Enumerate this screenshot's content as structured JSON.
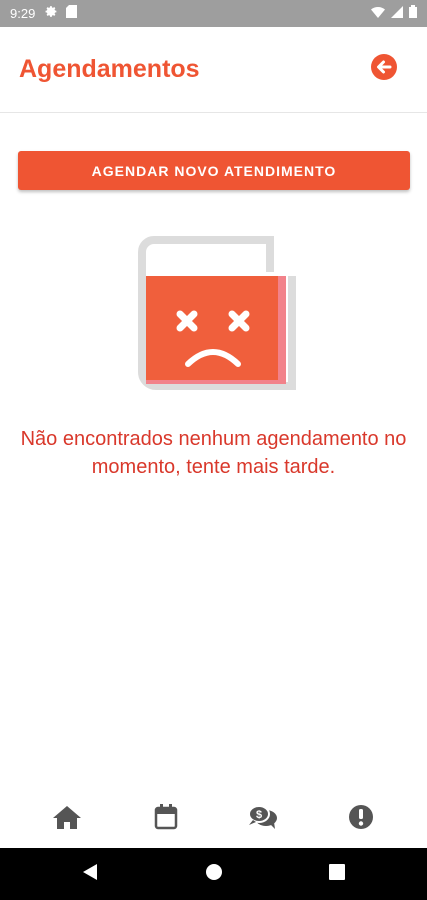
{
  "status_bar": {
    "time": "9:29",
    "icons": [
      "gear-icon",
      "sim-card-icon",
      "wifi-icon",
      "cellular-signal-icon",
      "battery-icon"
    ]
  },
  "header": {
    "title": "Agendamentos",
    "back_icon": "arrow-left-circle-icon"
  },
  "actions": {
    "new_appointment_label": "AGENDAR NOVO ATENDIMENTO"
  },
  "empty_state": {
    "illustration": "sad-book-icon",
    "message": "Não encontrados nenhum agendamento no momento, tente mais tarde."
  },
  "bottom_nav": {
    "items": [
      {
        "icon": "home-icon"
      },
      {
        "icon": "calendar-icon"
      },
      {
        "icon": "chat-money-icon"
      },
      {
        "icon": "alert-circle-icon"
      }
    ]
  },
  "system_nav": [
    "back-triangle-icon",
    "home-circle-icon",
    "recents-square-icon"
  ],
  "colors": {
    "accent": "#ef5533",
    "message": "#d9382b",
    "status_bar": "#9e9e9e",
    "nav_icon": "#555555"
  }
}
